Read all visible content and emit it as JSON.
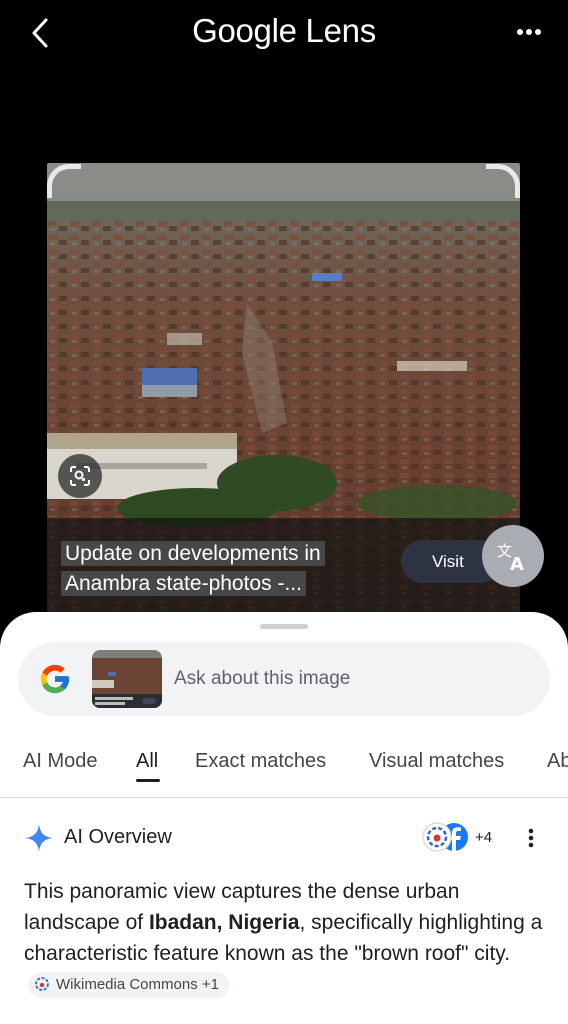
{
  "header": {
    "title": "Google Lens"
  },
  "result_card": {
    "caption_line1": "Update on developments in",
    "caption_line2": "Anambra state-photos -...",
    "visit_label": "Visit"
  },
  "search": {
    "placeholder": "Ask about this image"
  },
  "tabs": [
    {
      "label": "AI Mode"
    },
    {
      "label": "All"
    },
    {
      "label": "Exact matches"
    },
    {
      "label": "Visual matches"
    },
    {
      "label": "Ab"
    }
  ],
  "active_tab": "All",
  "ai_overview": {
    "title": "AI Overview",
    "source_count": "+4",
    "text_before": "This panoramic view captures the dense urban landscape of ",
    "text_bold": "Ibadan, Nigeria",
    "text_after": ", specifically highlighting a characteristic feature known as the \"brown roof\" city.",
    "citation_chip": "Wikimedia Commons +1"
  },
  "colors": {
    "background": "#000000",
    "sheet": "#ffffff",
    "pill": "#f1f3f4",
    "ai_star": "#4285f4"
  },
  "icons": [
    "back-arrow-icon",
    "more-icon",
    "lens-search-icon",
    "translate-icon",
    "google-g-icon",
    "sparkle-icon",
    "wikimedia-icon",
    "facebook-icon",
    "kebab-icon"
  ]
}
